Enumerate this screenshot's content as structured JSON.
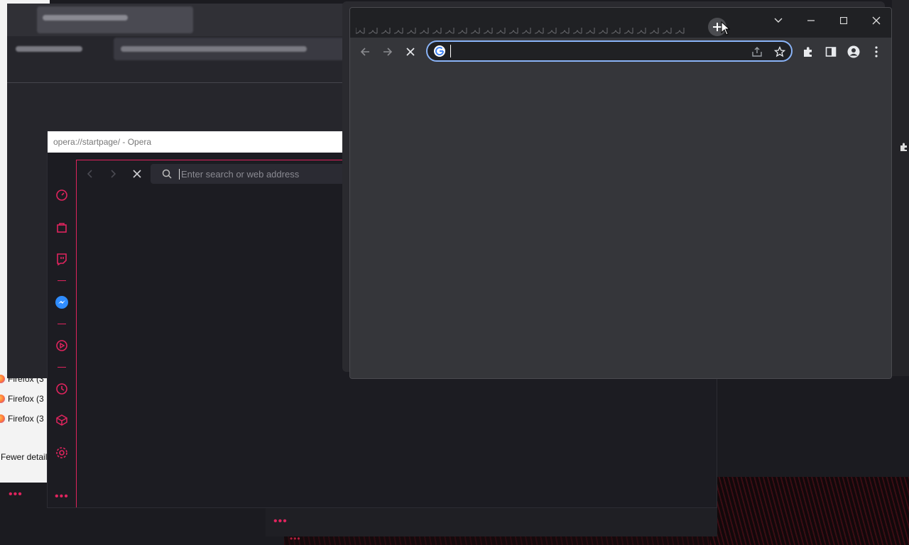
{
  "colors": {
    "opera_accent": "#e0245e",
    "chrome_focus": "#8ab4f8",
    "chrome_bg": "#35363a"
  },
  "taskmgr": {
    "rows": [
      "Firefox (3",
      "Firefox (3",
      "Firefox (3"
    ],
    "fewer_details": "Fewer details"
  },
  "opera": {
    "title": "opera://startpage/ - Opera",
    "search_placeholder": "Enter search or web address",
    "sidebar_icons": [
      "speed-dial-icon",
      "shopping-bag-icon",
      "twitch-icon",
      "messenger-icon",
      "player-icon",
      "history-icon",
      "crypto-wallet-icon",
      "settings-icon"
    ],
    "more": "•••"
  },
  "chrome": {
    "omnibox_value": "",
    "icons": [
      "back-icon",
      "forward-icon",
      "stop-icon",
      "google-icon",
      "share-icon",
      "bookmark-star-icon",
      "extensions-icon",
      "side-panel-icon",
      "profile-icon",
      "menu-icon",
      "new-tab-icon",
      "tab-search-icon",
      "minimize-icon",
      "maximize-icon",
      "close-icon"
    ]
  },
  "misc_dots": "•••"
}
